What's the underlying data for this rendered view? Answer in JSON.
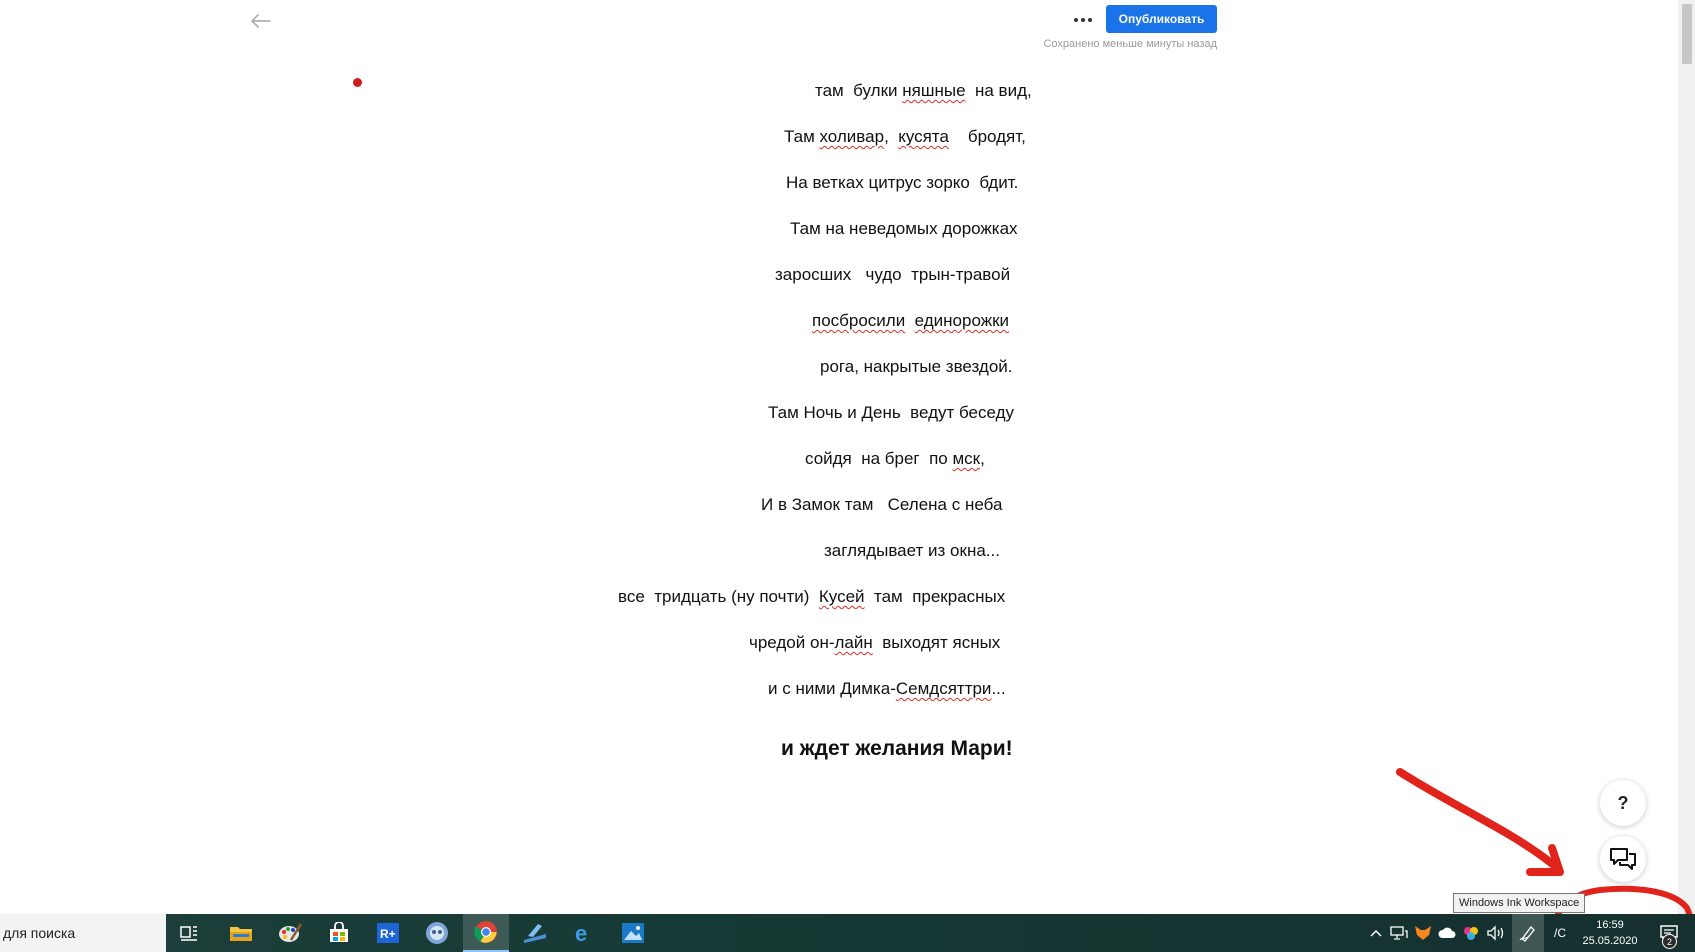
{
  "editor": {
    "publish_label": "Опубликовать",
    "save_status": "Сохранено меньше минуты назад"
  },
  "poem": {
    "lines": [
      [
        "там  булки ",
        {
          "t": "няшные",
          "sp": true
        },
        "  на вид,"
      ],
      [
        "Там ",
        {
          "t": "холивар",
          "sp": true
        },
        ",  ",
        {
          "t": "кусята",
          "sp": true
        },
        "    бродят,"
      ],
      [
        "На ветках цитрус зорко  бдит."
      ],
      [
        "Там на неведомых дорожках"
      ],
      [
        "заросших   чудо  трын-травой"
      ],
      [
        {
          "t": "посбросили",
          "sp": true
        },
        "  ",
        {
          "t": "единорожки",
          "sp": true
        }
      ],
      [
        "рога, накрытые звездой."
      ],
      [
        "Там Ночь и День  ведут беседу"
      ],
      [
        "сойдя  на брег  по ",
        {
          "t": "мск",
          "sp": true
        },
        ","
      ],
      [
        "И в Замок там   Селена с неба"
      ],
      [
        "заглядывает из окна..."
      ],
      [
        "все  тридцать (ну почти)  ",
        {
          "t": "Кусей",
          "sp": true
        },
        "  там  прекрасных"
      ],
      [
        "чредой он-",
        {
          "t": "лайн",
          "sp": true
        },
        "  выходят ясных"
      ],
      [
        "и с ними Димка-",
        {
          "t": "Семдсяттри",
          "sp": true
        },
        "..."
      ]
    ],
    "final_line": "и ждет желания Мари!"
  },
  "floating": {
    "help_label": "?"
  },
  "tooltip": {
    "text": "Windows Ink Workspace"
  },
  "taskbar": {
    "search_placeholder": "для поиска",
    "apps": [
      "task-view",
      "file-explorer",
      "paint",
      "microsoft-store",
      "rplus",
      "ok",
      "chrome",
      "app-blue",
      "edge",
      "photos"
    ],
    "tray_lang": "/C",
    "clock_time": "16:59",
    "clock_date": "25.05.2020",
    "notification_count": "2"
  },
  "colors": {
    "publish_button": "#1a73e8",
    "annotation_red": "#e0231b",
    "spellcheck": "#d93025"
  }
}
